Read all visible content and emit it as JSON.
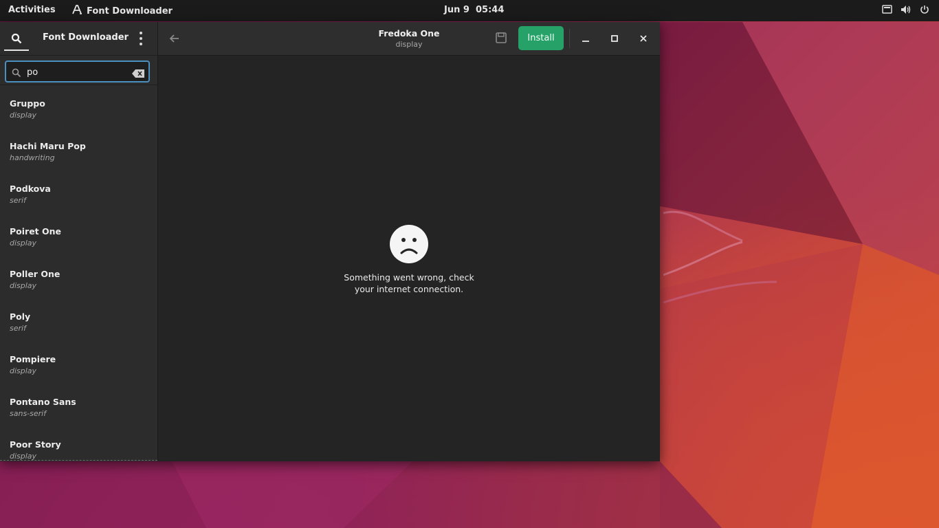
{
  "topbar": {
    "activities": "Activities",
    "app_name": "Font Downloader",
    "date": "Jun 9",
    "time": "05:44"
  },
  "sidebar": {
    "title": "Font Downloader",
    "search": {
      "value": "po",
      "placeholder": ""
    },
    "fonts": [
      {
        "name": "Gruppo",
        "category": "display"
      },
      {
        "name": "Hachi Maru Pop",
        "category": "handwriting"
      },
      {
        "name": "Podkova",
        "category": "serif"
      },
      {
        "name": "Poiret One",
        "category": "display"
      },
      {
        "name": "Poller One",
        "category": "display"
      },
      {
        "name": "Poly",
        "category": "serif"
      },
      {
        "name": "Pompiere",
        "category": "display"
      },
      {
        "name": "Pontano Sans",
        "category": "sans-serif"
      },
      {
        "name": "Poor Story",
        "category": "display"
      }
    ]
  },
  "content": {
    "title": "Fredoka One",
    "subtitle": "display",
    "install_label": "Install",
    "error_message": "Something went wrong, check your internet connection."
  },
  "colors": {
    "accent_green": "#26a269",
    "focus_blue": "#4a90c0",
    "topbar_bg": "#1b1b1b",
    "sidebar_bg": "#2c2c2c",
    "content_bg": "#242424"
  },
  "icons": {
    "topbar_app": "font-a-icon",
    "tray": [
      "screen-icon",
      "volume-icon",
      "power-icon"
    ],
    "sidebar": [
      "search-icon",
      "kebab-menu-icon"
    ],
    "entry": [
      "magnifier-icon",
      "clear-backspace-icon"
    ],
    "header": [
      "back-arrow-icon",
      "save-icon",
      "minimize-icon",
      "maximize-icon",
      "close-icon"
    ],
    "error": "sad-face-icon"
  }
}
